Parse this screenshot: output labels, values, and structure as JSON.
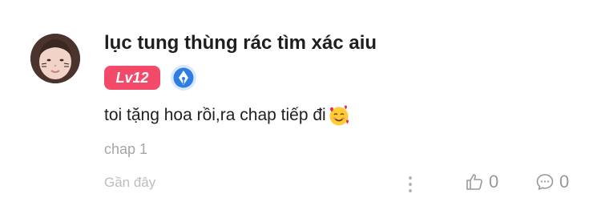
{
  "comment": {
    "username": "lục tung thùng rác tìm xác aiu",
    "level": "Lv12",
    "text": "toi tặng hoa rồi,ra chap tiếp đi",
    "chapter": "chap 1",
    "time": "Gần đây",
    "likes": "0",
    "replies": "0"
  },
  "colors": {
    "level_badge": "#f34a6a",
    "pen_badge": "#2f7de1",
    "muted_text": "#a6a6a6"
  },
  "icons": {
    "avatar": "user-avatar",
    "level": "level-badge",
    "pen": "fountain-pen-icon",
    "emoji": "smiling-face-with-hearts-icon",
    "more": "more-vertical-icon",
    "like": "thumbs-up-icon",
    "reply": "chat-bubble-icon"
  }
}
